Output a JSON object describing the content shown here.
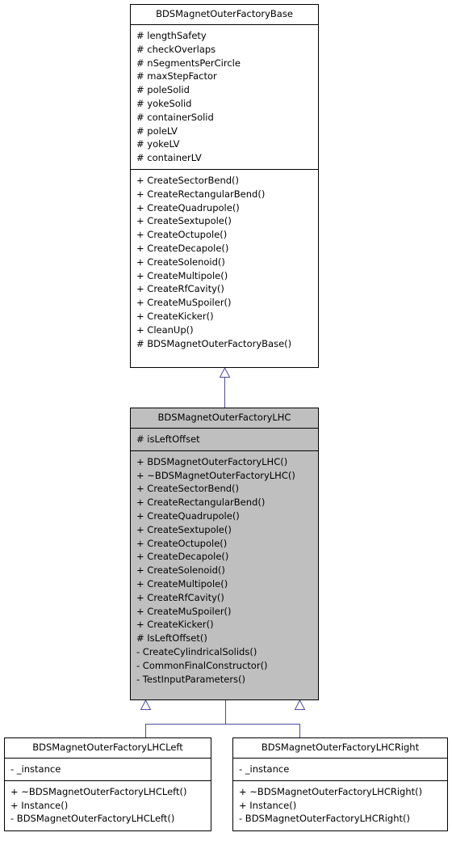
{
  "diagram": {
    "type": "uml-class-inheritance",
    "edge_color": "#4b4b9e",
    "fill_color": "#bfbfbf",
    "classes": [
      {
        "id": "base",
        "title": "BDSMagnetOuterFactoryBase",
        "attributes": [
          "# lengthSafety",
          "# checkOverlaps",
          "# nSegmentsPerCircle",
          "# maxStepFactor",
          "# poleSolid",
          "# yokeSolid",
          "# containerSolid",
          "# poleLV",
          "# yokeLV",
          "# containerLV"
        ],
        "methods": [
          "+ CreateSectorBend()",
          "+ CreateRectangularBend()",
          "+ CreateQuadrupole()",
          "+ CreateSextupole()",
          "+ CreateOctupole()",
          "+ CreateDecapole()",
          "+ CreateSolenoid()",
          "+ CreateMultipole()",
          "+ CreateRfCavity()",
          "+ CreateMuSpoiler()",
          "+ CreateKicker()",
          "+ CleanUp()",
          "# BDSMagnetOuterFactoryBase()"
        ]
      },
      {
        "id": "lhc",
        "title": "BDSMagnetOuterFactoryLHC",
        "attributes": [
          "# isLeftOffset"
        ],
        "methods": [
          "+ BDSMagnetOuterFactoryLHC()",
          "+ ~BDSMagnetOuterFactoryLHC()",
          "+ CreateSectorBend()",
          "+ CreateRectangularBend()",
          "+ CreateQuadrupole()",
          "+ CreateSextupole()",
          "+ CreateOctupole()",
          "+ CreateDecapole()",
          "+ CreateSolenoid()",
          "+ CreateMultipole()",
          "+ CreateRfCavity()",
          "+ CreateMuSpoiler()",
          "+ CreateKicker()",
          "# IsLeftOffset()",
          "- CreateCylindricalSolids()",
          "- CommonFinalConstructor()",
          "- TestInputParameters()"
        ]
      },
      {
        "id": "left",
        "title": "BDSMagnetOuterFactoryLHCLeft",
        "attributes": [
          "- _instance"
        ],
        "methods": [
          "+ ~BDSMagnetOuterFactoryLHCLeft()",
          "+ Instance()",
          "- BDSMagnetOuterFactoryLHCLeft()"
        ]
      },
      {
        "id": "right",
        "title": "BDSMagnetOuterFactoryLHCRight",
        "attributes": [
          "- _instance"
        ],
        "methods": [
          "+ ~BDSMagnetOuterFactoryLHCRight()",
          "+ Instance()",
          "- BDSMagnetOuterFactoryLHCRight()"
        ]
      }
    ]
  }
}
